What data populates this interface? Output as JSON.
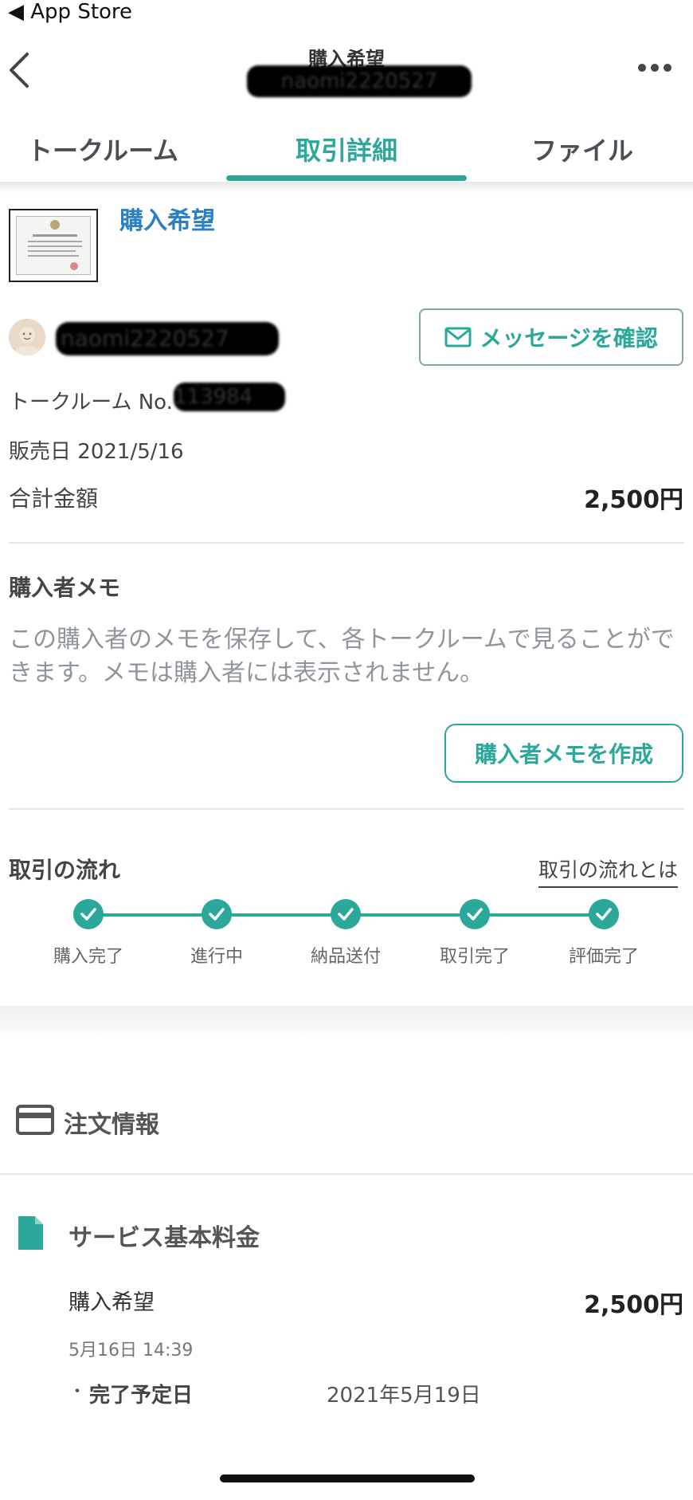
{
  "status_bar": {
    "back_app": "◀ App Store"
  },
  "header": {
    "title": "購入希望",
    "subtitle": "naomi2220527"
  },
  "tabs": [
    {
      "label": "トークルーム",
      "active": false
    },
    {
      "label": "取引詳細",
      "active": true
    },
    {
      "label": "ファイル",
      "active": false
    }
  ],
  "product": {
    "title": "購入希望"
  },
  "user": {
    "name": "naomi2220527"
  },
  "message_button": {
    "label": "メッセージを確認"
  },
  "talk_room": {
    "label": "トークルーム No.",
    "number": "113984"
  },
  "sale_date": {
    "label": "販売日",
    "value": "2021/5/16"
  },
  "total": {
    "label": "合計金額",
    "value": "2,500円"
  },
  "buyer_memo": {
    "heading": "購入者メモ",
    "description": "この購入者のメモを保存して、各トークルームで見ることができます。メモは購入者には表示されません。",
    "button": "購入者メモを作成"
  },
  "flow": {
    "heading": "取引の流れ",
    "link": "取引の流れとは",
    "steps": [
      {
        "label": "購入完了",
        "done": true
      },
      {
        "label": "進行中",
        "done": true
      },
      {
        "label": "納品送付",
        "done": true
      },
      {
        "label": "取引完了",
        "done": true
      },
      {
        "label": "評価完了",
        "done": true
      }
    ]
  },
  "order_info": {
    "heading": "注文情報",
    "service": {
      "heading": "サービス基本料金",
      "item_name": "購入希望",
      "item_price": "2,500円",
      "item_time": "5月16日 14:39",
      "due_bullet": "・",
      "due_label": "完了予定日",
      "due_value": "2021年5月19日"
    }
  },
  "colors": {
    "accent": "#2ba89a",
    "link_blue": "#2b7fc4"
  },
  "icons": [
    "chevron-left-icon",
    "more-dots-icon",
    "mail-icon",
    "check-icon",
    "credit-card-icon",
    "file-icon"
  ]
}
